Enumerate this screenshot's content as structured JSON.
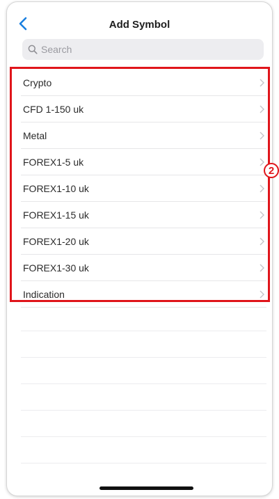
{
  "header": {
    "title": "Add Symbol",
    "back_icon": "chevron-left-icon"
  },
  "search": {
    "placeholder": "Search",
    "icon": "search-icon"
  },
  "symbol_groups": [
    {
      "label": "Crypto"
    },
    {
      "label": "CFD 1-150 uk"
    },
    {
      "label": "Metal"
    },
    {
      "label": "FOREX1-5 uk"
    },
    {
      "label": "FOREX1-10 uk"
    },
    {
      "label": "FOREX1-15 uk"
    },
    {
      "label": "FOREX1-20 uk"
    },
    {
      "label": "FOREX1-30 uk"
    },
    {
      "label": "Indication"
    }
  ],
  "annotation": {
    "badge_number": "2",
    "color": "#e0151b"
  },
  "colors": {
    "accent": "#1a7fe0",
    "chevron": "#c4c4c8"
  }
}
